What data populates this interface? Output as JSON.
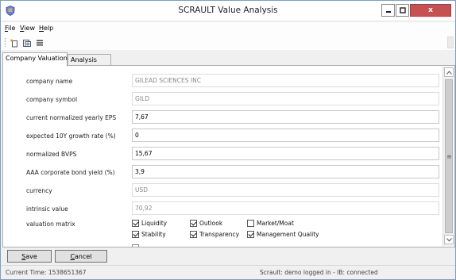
{
  "window": {
    "title": "SCRAULT Value Analysis",
    "close_label": "x"
  },
  "menu": {
    "items": [
      {
        "mnemonic": "F",
        "rest": "ile"
      },
      {
        "mnemonic": "V",
        "rest": "iew"
      },
      {
        "mnemonic": "H",
        "rest": "elp"
      }
    ]
  },
  "toolbar": {
    "buttons": [
      "new-icon",
      "open-icon",
      "list-icon"
    ]
  },
  "tabs": [
    {
      "label": "Company Valuation",
      "active": true
    },
    {
      "label": "Analysis",
      "active": false
    }
  ],
  "form": {
    "company_name": {
      "label": "company name",
      "value": "GILEAD SCIENCES INC"
    },
    "company_symbol": {
      "label": "company symbol",
      "value": "GILD"
    },
    "eps": {
      "label": "current normalized yearly EPS",
      "value": "7,67"
    },
    "growth": {
      "label": "expected 10Y growth rate (%)",
      "value": "0"
    },
    "bvps": {
      "label": "normalized BVPS",
      "value": "15,67"
    },
    "bond_yield": {
      "label": "AAA corporate bond yield (%)",
      "value": "3,9"
    },
    "currency": {
      "label": "currency",
      "value": "USD"
    },
    "intrinsic": {
      "label": "intrinsic value",
      "value": "70,92"
    },
    "matrix": {
      "label": "valuation matrix",
      "options": [
        {
          "label": "Liquidity",
          "checked": true
        },
        {
          "label": "Outlook",
          "checked": true
        },
        {
          "label": "Market/Moat",
          "checked": false
        },
        {
          "label": "Stability",
          "checked": true
        },
        {
          "label": "Transparency",
          "checked": true
        },
        {
          "label": "Management Quality",
          "checked": true
        }
      ]
    }
  },
  "buttons": {
    "save": {
      "mnemonic": "S",
      "rest": "ave"
    },
    "cancel": {
      "mnemonic": "C",
      "rest": "ancel"
    }
  },
  "status": {
    "left": "Current Time: 1538651367",
    "right": "Scrault: demo logged in - IB: connected"
  }
}
